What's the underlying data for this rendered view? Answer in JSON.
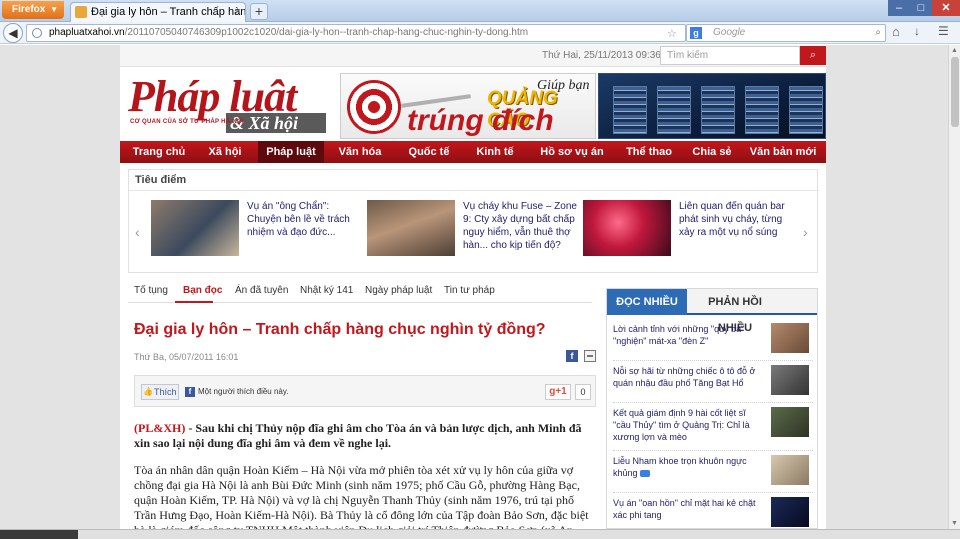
{
  "browser": {
    "menu_label": "Firefox",
    "tab_title": "Đại gia ly hôn – Tranh chấp hàng chục n...",
    "url_domain": "phapluatxahoi.vn",
    "url_path": "/20110705040746309p1002c1020/dai-gia-ly-hon--tranh-chap-hang-chuc-nghin-ty-dong.htm",
    "search_placeholder": "Google"
  },
  "site": {
    "date": "Thứ Hai, 25/11/2013 09:36",
    "search_placeholder": "Tìm kiếm",
    "logo_main": "Pháp luật",
    "logo_sub": "& Xã hội",
    "logo_tagline": "CƠ QUAN CỦA SỞ TƯ PHÁP HÀ NỘI",
    "ad_line1": "Giúp bạn",
    "ad_line2": "QUẢNG CÁO",
    "ad_line3": "trúng đích"
  },
  "menu": [
    "Trang chủ",
    "Xã hội",
    "Pháp luật",
    "Văn hóa",
    "Quốc tế",
    "Kinh tế",
    "Hồ sơ vụ án",
    "Thể thao",
    "Chia sẻ",
    "Văn bản mới"
  ],
  "menu_active_index": 2,
  "tieudiem": {
    "title": "Tiêu điểm",
    "items": [
      {
        "text": "Vụ án \"ông Chẩn\": Chuyện bên lề về trách nhiệm và đạo đức..."
      },
      {
        "text": "Vụ cháy khu Fuse – Zone 9: Cty xây dựng bất chấp nguy hiểm, vẫn thuê thợ hàn... cho kịp tiến độ?"
      },
      {
        "text": "Liên quan đến quán bar phát sinh vụ cháy, từng xảy ra một vụ nổ súng"
      }
    ]
  },
  "category_tabs": [
    "Tố tụng",
    "Bạn đọc",
    "Án đã tuyên",
    "Nhật ký 141",
    "Ngày pháp luật",
    "Tin tư pháp"
  ],
  "category_active_index": 1,
  "article": {
    "title": "Đại gia ly hôn – Tranh chấp hàng chục nghìn tỷ đồng?",
    "date": "Thứ Ba, 05/07/2011 16:01",
    "like_label": "Thích",
    "like_count_text": "Một người thích điều này.",
    "gplus_label": "g+1",
    "gplus_count": "0",
    "lead_tag": "(PL&XH)",
    "lead": " - Sau khi chị Thủy nộp đĩa ghi âm cho Tòa án và bản lược dịch, anh Minh đã xin sao lại nội dung đĩa ghi âm và đem về nghe lại.",
    "body": "Tòa án nhân dân quận Hoàn Kiếm – Hà Nội vừa mở phiên tòa xét xử vụ ly hôn của giữa vợ chồng đại gia Hà Nội là anh Bùi Đức Minh (sinh năm 1975; phố Cầu Gỗ, phường Hàng Bạc, quận Hoàn Kiếm, TP. Hà Nội) và vợ là chị Nguyễn Thanh Thủy (sinh năm 1976, trú tại phố Trần Hưng Đạo, Hoàn Kiếm-Hà Nội). Bà Thủy là cổ đông lớn của Tập đoàn Bảo Sơn, đặc biệt bà là giám đốc công ty TNHH Một thành viên Du lịch giải trí Thiên đường Bảo Sơn (xã An Khánh, huyện Hoài Đức, thành"
  },
  "sidebar": {
    "tab_active": "ĐỌC NHIỀU",
    "tab_inactive": "PHẢN HỒI NHIỀU",
    "items": [
      {
        "text": "Lời cảnh tỉnh với những \"quý bà\" \"nghiện\" mát-xa \"đèn Z\""
      },
      {
        "text": "Nỗi sợ hãi từ những chiếc ô tô đỗ ở quán nhậu đầu phố Tăng Bạt Hổ"
      },
      {
        "text": "Kết quả giám định 9 hài cốt liệt sĩ \"cầu Thủy\" tìm ở Quảng Trị: Chỉ là xương lợn và mèo"
      },
      {
        "text": "Liễu Nham khoe trọn khuôn ngực khủng"
      },
      {
        "text": "Vụ án \"oan hồn\" chỉ mặt hai kẻ chặt xác phi tang"
      }
    ]
  },
  "colors": {
    "brand_red": "#c0181c",
    "menu_active": "#5e0a0d",
    "tab_blue": "#2d6bb5"
  }
}
